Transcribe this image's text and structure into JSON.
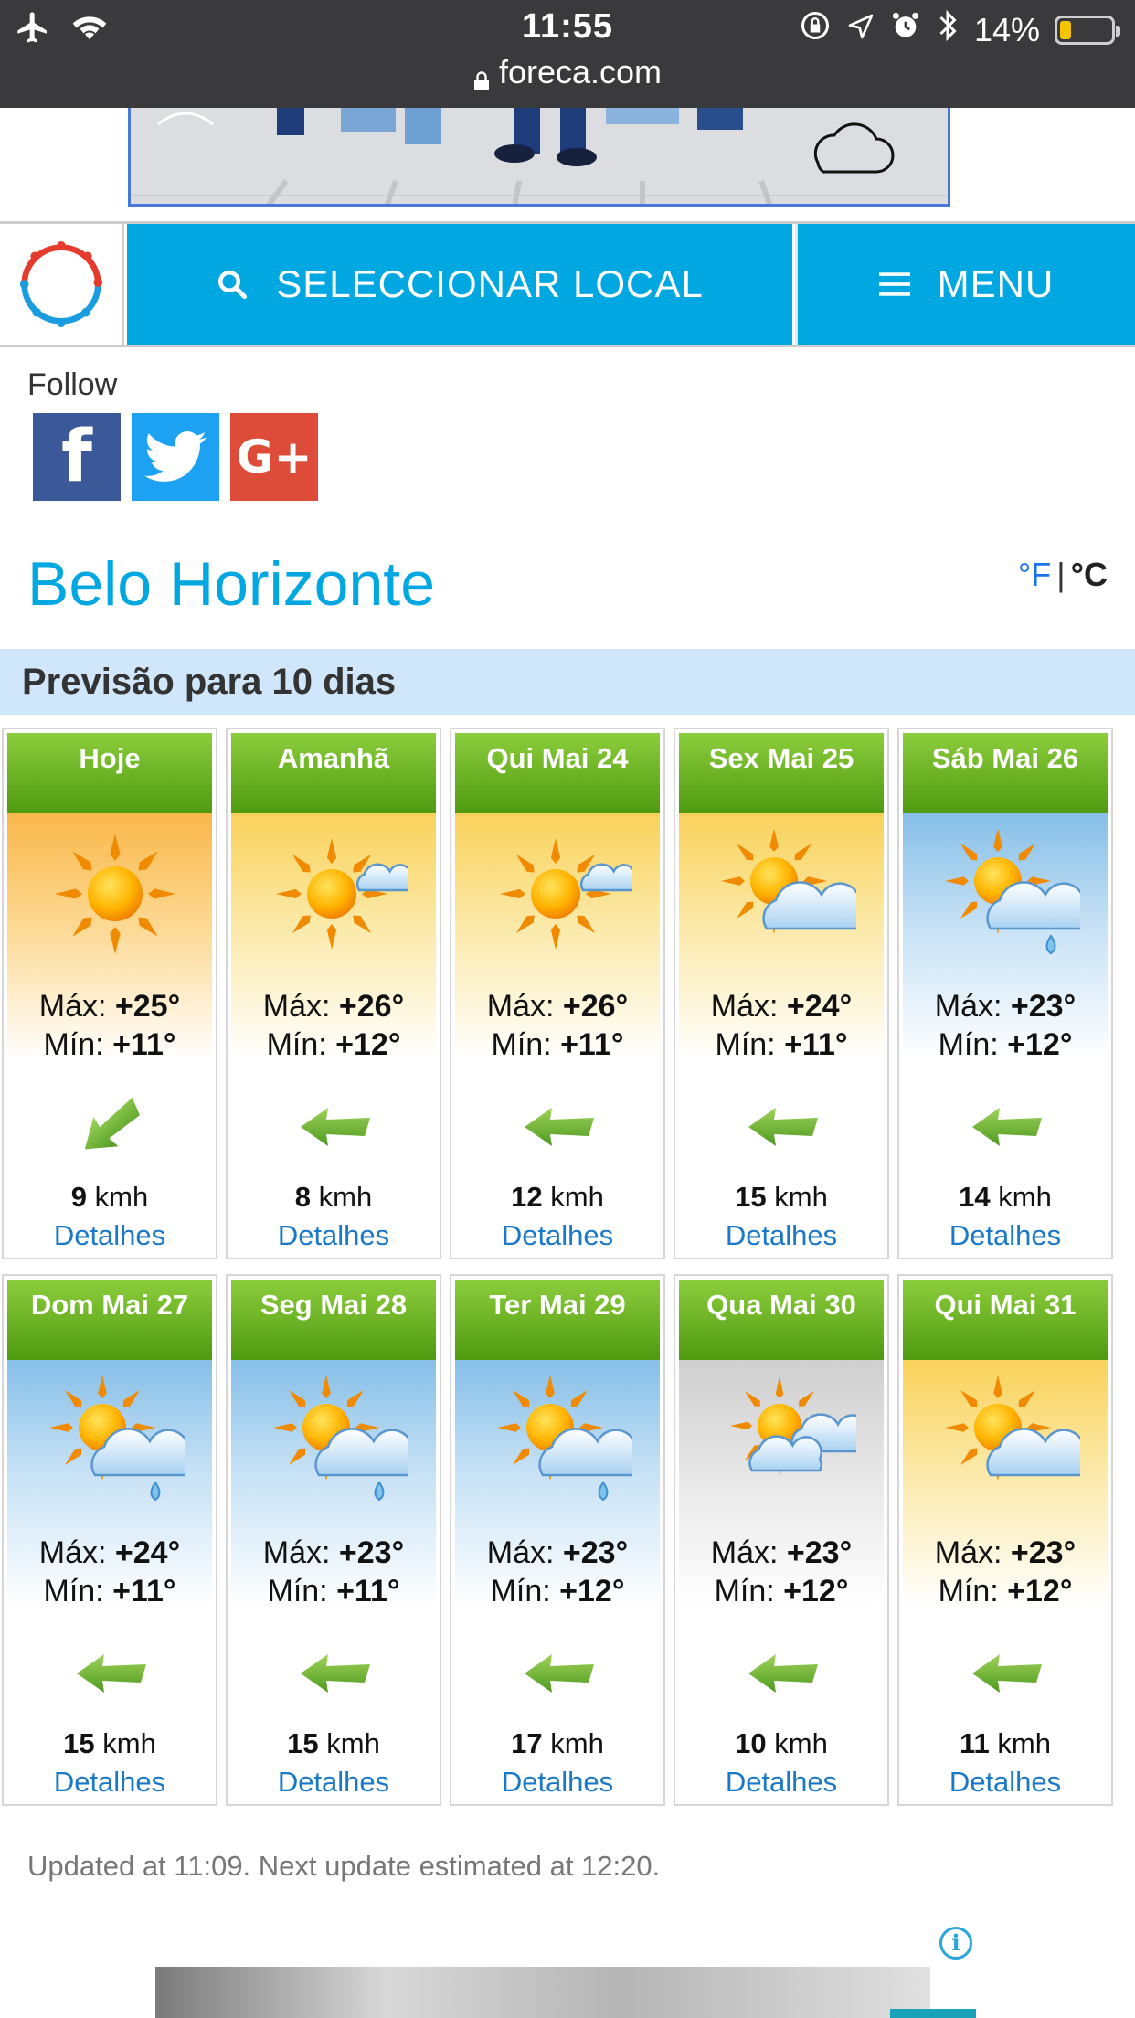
{
  "status_bar": {
    "time": "11:55",
    "url": "foreca.com",
    "battery": "14%",
    "battery_level": 0.14
  },
  "nav": {
    "select_label": "SELECCIONAR LOCAL",
    "menu_label": "MENU"
  },
  "follow": {
    "label": "Follow",
    "networks": [
      "facebook",
      "twitter",
      "google-plus"
    ],
    "google_plus_text": "G+"
  },
  "city": "Belo Horizonte",
  "units": {
    "f": "°F",
    "separator": "|",
    "c": "°C"
  },
  "forecast": {
    "title": "Previsão para 10 dias",
    "max_prefix": "Máx:",
    "min_prefix": "Mín:",
    "speed_unit": "kmh",
    "details_label": "Detalhes",
    "days": [
      {
        "label": "Hoje",
        "max": "+25°",
        "min": "+11°",
        "wind": "9",
        "icon": "sun",
        "bg": "hot",
        "wind_dir": "sw"
      },
      {
        "label": "Amanhã",
        "max": "+26°",
        "min": "+12°",
        "wind": "8",
        "icon": "sun-small-cloud",
        "bg": "warm",
        "wind_dir": "w"
      },
      {
        "label": "Qui Mai 24",
        "max": "+26°",
        "min": "+11°",
        "wind": "12",
        "icon": "sun-small-cloud",
        "bg": "warm",
        "wind_dir": "w"
      },
      {
        "label": "Sex Mai 25",
        "max": "+24°",
        "min": "+11°",
        "wind": "15",
        "icon": "sun-cloud",
        "bg": "warm",
        "wind_dir": "w"
      },
      {
        "label": "Sáb Mai 26",
        "max": "+23°",
        "min": "+12°",
        "wind": "14",
        "icon": "sun-cloud-rain",
        "bg": "blue",
        "wind_dir": "w"
      },
      {
        "label": "Dom Mai 27",
        "max": "+24°",
        "min": "+11°",
        "wind": "15",
        "icon": "sun-cloud-rain",
        "bg": "blue",
        "wind_dir": "w"
      },
      {
        "label": "Seg Mai 28",
        "max": "+23°",
        "min": "+11°",
        "wind": "15",
        "icon": "sun-cloud-rain",
        "bg": "blue",
        "wind_dir": "w"
      },
      {
        "label": "Ter Mai 29",
        "max": "+23°",
        "min": "+12°",
        "wind": "17",
        "icon": "sun-cloud-rain",
        "bg": "blue",
        "wind_dir": "w"
      },
      {
        "label": "Qua Mai 30",
        "max": "+23°",
        "min": "+12°",
        "wind": "10",
        "icon": "sun-two-clouds",
        "bg": "grey",
        "wind_dir": "w"
      },
      {
        "label": "Qui Mai 31",
        "max": "+23°",
        "min": "+12°",
        "wind": "11",
        "icon": "sun-cloud",
        "bg": "warm",
        "wind_dir": "w"
      }
    ]
  },
  "updated_text": "Updated at 11:09. Next update estimated at 12:20.",
  "colors": {
    "accent": "#00a7e1",
    "header_green_top": "#8ccd3c",
    "header_green_bottom": "#4f9a10",
    "link": "#1a78c8",
    "forecast_bar": "#cfe6fb"
  }
}
